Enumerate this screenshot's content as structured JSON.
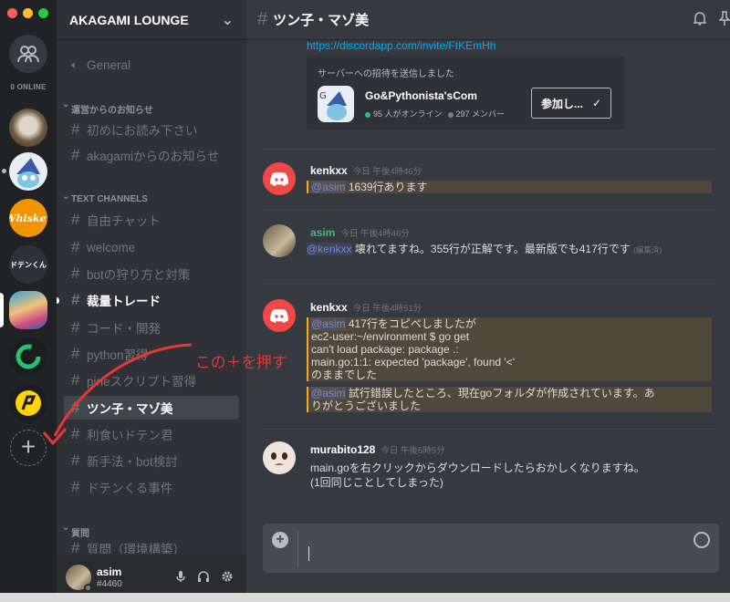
{
  "window": {
    "traffic_colors": [
      "#ff5f57",
      "#febc2e",
      "#28c840"
    ]
  },
  "rail": {
    "online_label": "0 ONLINE",
    "dotenkun_label": "ドテンくん",
    "whiskey_label": "Whiskey"
  },
  "guild": {
    "name": "AKAGAMI LOUNGE"
  },
  "categories": {
    "unyou": "運営からのお知らせ",
    "text": "TEXT CHANNELS",
    "shitsumon": "質問"
  },
  "channels": {
    "general": "General",
    "c1": "初めにお読み下さい",
    "c2": "akagamiからのお知らせ",
    "c3": "自由チャット",
    "c4": "welcome",
    "c5": "botの狩り方と対策",
    "c6": "裁量トレード",
    "c7": "コード・開発",
    "c8": "python習得",
    "c9": "pineスクリプト習得",
    "c10": "ツン子・マゾ美",
    "c11": "利食いドテン君",
    "c12": "新手法・bot検討",
    "c13": "ドテンくる事件",
    "c14": "質問（環境構築）"
  },
  "user": {
    "name": "asim",
    "tag": "#4460"
  },
  "chat": {
    "title": "ツン子・マゾ美",
    "invite_link": "https://discordapp.com/invite/FtKEmHh",
    "invite": {
      "title": "サーバーへの招待を送信しました",
      "name": "Go&Pythonista'sCom",
      "online": "95 人がオンライン",
      "members": "297 メンバー",
      "button": "参加し..."
    },
    "messages": [
      {
        "author": "kenkxx",
        "time": "今日 午後4時46分",
        "mention": "@asim",
        "text": " 1639行あります"
      },
      {
        "author": "asim",
        "time": "今日 午後4時46分",
        "mention": "@kenkxx",
        "text": " 壊れてますね。355行が正解です。最新版でも417行です",
        "edited": "(編集済)"
      },
      {
        "author": "kenkxx",
        "time": "今日 午後4時51分",
        "mention": "@asim",
        "lines": [
          "417行をコピペしましたが",
          "ec2-user:~/environment $ go get",
          "can't load package: package .:",
          "main.go:1:1: expected 'package', found '<'",
          "のままでした"
        ],
        "mention2": "@asim",
        "text2a": " 試行錯誤したところ、現在goフォルダが作成されています。あ",
        "text2b": "りがとうございました"
      },
      {
        "author": "murabito128",
        "time": "今日 午後5時5分",
        "line1": "main.goを右クリックからダウンロードしたらおかしくなりますね。",
        "line2": "(1回同じことしてしまった)"
      }
    ]
  },
  "annotation": "この＋を押す",
  "colors": {
    "accent": "#7289da",
    "online": "#43b581",
    "annot": "#e53935",
    "discord": "#f04747"
  }
}
